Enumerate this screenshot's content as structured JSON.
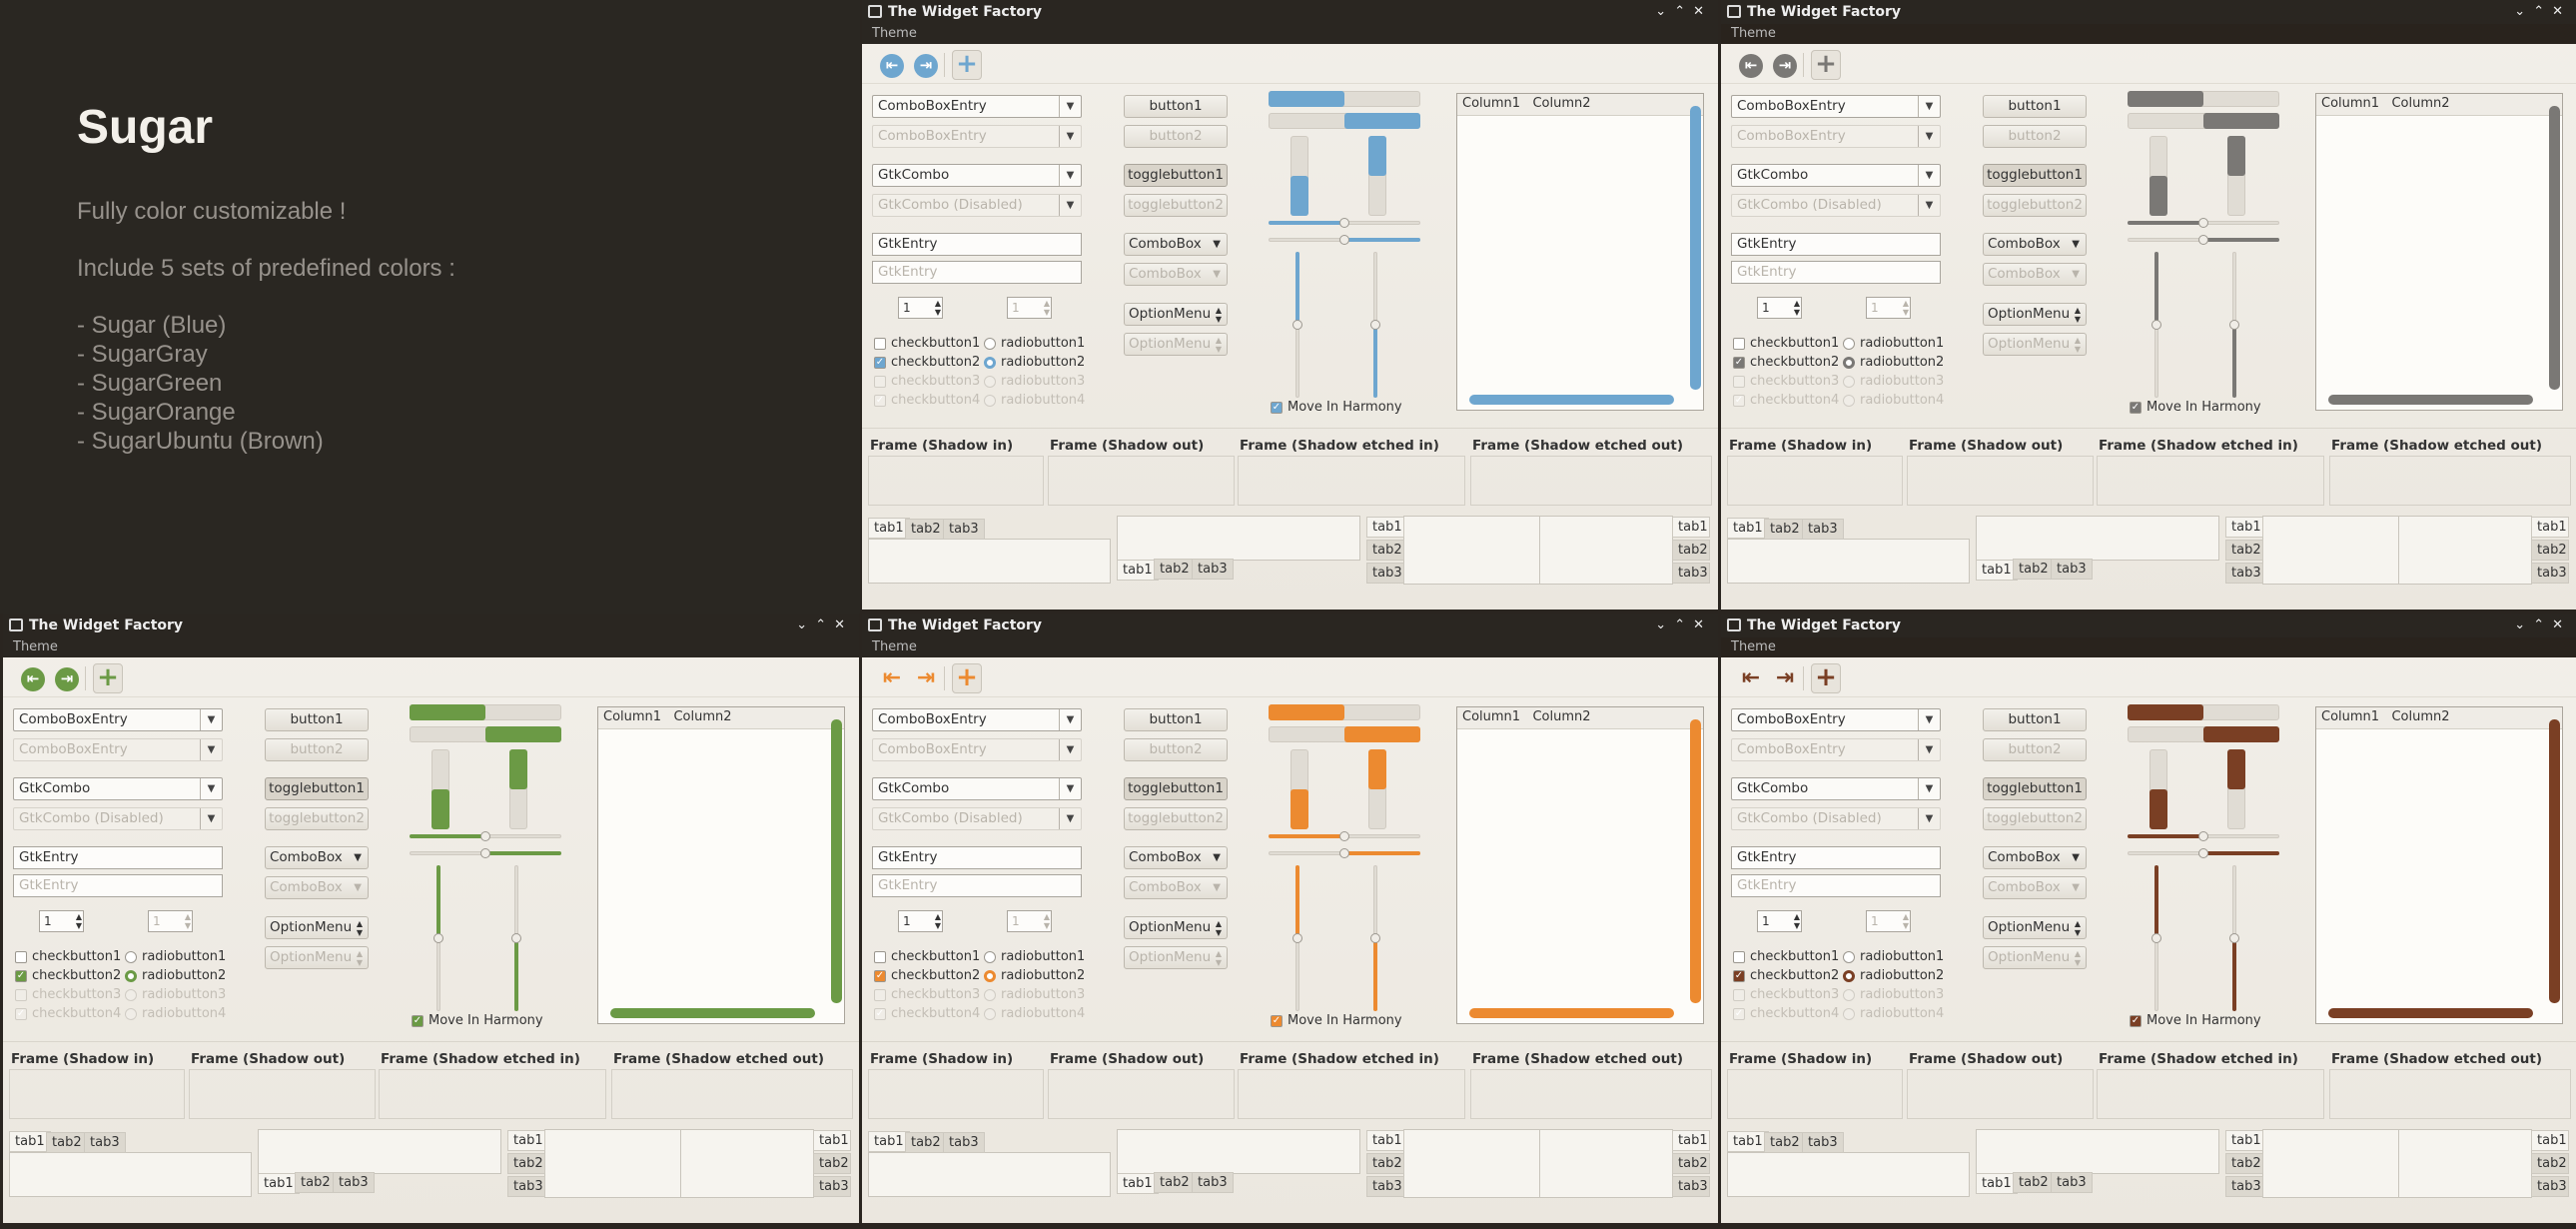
{
  "intro": {
    "title": "Sugar",
    "line1": "Fully color customizable !",
    "line2": "Include 5 sets of predefined colors :",
    "items": [
      "- Sugar (Blue)",
      "- SugarGray",
      "- SugarGreen",
      "- SugarOrange",
      "- SugarUbuntu (Brown)"
    ]
  },
  "window": {
    "title": "The Widget Factory",
    "menu": "Theme",
    "combo_entry": "ComboBoxEntry",
    "combo_entry_disabled": "ComboBoxEntry",
    "gtk_combo": "GtkCombo",
    "gtk_combo_disabled": "GtkCombo (Disabled)",
    "entry": "GtkEntry",
    "entry_disabled": "GtkEntry",
    "spin_value": "1",
    "spin_value_disabled": "1",
    "checkbuttons": [
      "checkbutton1",
      "checkbutton2",
      "checkbutton3",
      "checkbutton4"
    ],
    "radiobuttons": [
      "radiobutton1",
      "radiobutton2",
      "radiobutton3",
      "radiobutton4"
    ],
    "button1": "button1",
    "button2": "button2",
    "toggle1": "togglebutton1",
    "toggle2": "togglebutton2",
    "combobox": "ComboBox",
    "combobox_disabled": "ComboBox",
    "optionmenu": "OptionMenu",
    "optionmenu_disabled": "OptionMenu",
    "harmony": "Move In Harmony",
    "col1": "Column1",
    "col2": "Column2",
    "frames": [
      "Frame (Shadow in)",
      "Frame (Shadow out)",
      "Frame (Shadow etched in)",
      "Frame (Shadow etched out)"
    ],
    "tabs": [
      "tab1",
      "tab2",
      "tab3"
    ]
  },
  "themes": [
    {
      "name": "Sugar (Blue)",
      "accent": "#6ea6cf"
    },
    {
      "name": "SugarGray",
      "accent": "#7a7875"
    },
    {
      "name": "SugarGreen",
      "accent": "#6b9a45"
    },
    {
      "name": "SugarOrange",
      "accent": "#ec8a30"
    },
    {
      "name": "SugarUbuntu (Brown)",
      "accent": "#7a3f24"
    }
  ],
  "icons": [
    "window-icon",
    "back-icon",
    "forward-icon",
    "add-icon",
    "minimize-icon",
    "maximize-icon",
    "close-icon",
    "dropdown-arrow-icon"
  ]
}
